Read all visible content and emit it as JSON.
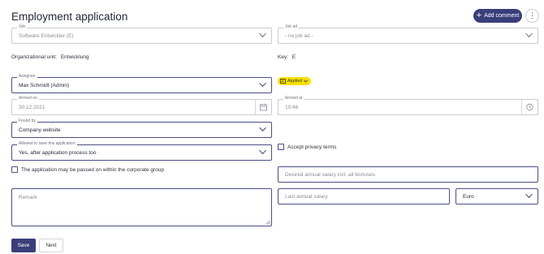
{
  "page": {
    "title": "Employment application"
  },
  "toolbar": {
    "add_comment_label": "Add comment",
    "plus_glyph": "+",
    "more_glyph": "⋮"
  },
  "form": {
    "job": {
      "label": "Job",
      "value": "Software Entwickler (E)"
    },
    "job_ad": {
      "label": "Job ad",
      "value": "- no job ad -"
    },
    "org_unit": {
      "label": "Organizational unit:",
      "value": "Entwicklung"
    },
    "key": {
      "label": "Key:",
      "value": "E"
    },
    "assignee": {
      "label": "Assignee",
      "value": "Max Schmidt (Admin)"
    },
    "status_badge": {
      "label": "Applied"
    },
    "arrived_on": {
      "label": "Arrived on",
      "value": "30.12.2021"
    },
    "arrived_at": {
      "label": "Arrived at",
      "value": "10:46"
    },
    "found_by": {
      "label": "Found by",
      "value": "Company website"
    },
    "allowed_to_save": {
      "label": "Allowed to save this application",
      "value": "Yes, after application process too"
    },
    "privacy": {
      "label": "Accept privacy terms",
      "checked": false
    },
    "pass_on": {
      "label": "The application may be passed on within the corporate group",
      "checked": false
    },
    "desired_salary": {
      "placeholder": "Desired annual salary incl. all bonuses"
    },
    "remark": {
      "placeholder": "Remark"
    },
    "last_salary": {
      "placeholder": "Last annual salary"
    },
    "currency": {
      "value": "Euro"
    }
  },
  "actions": {
    "save_label": "Save",
    "next_label": "Next"
  },
  "colors": {
    "primary": "#3a3f7a",
    "badge_bg": "#f7e000",
    "border": "#c8cad3"
  }
}
